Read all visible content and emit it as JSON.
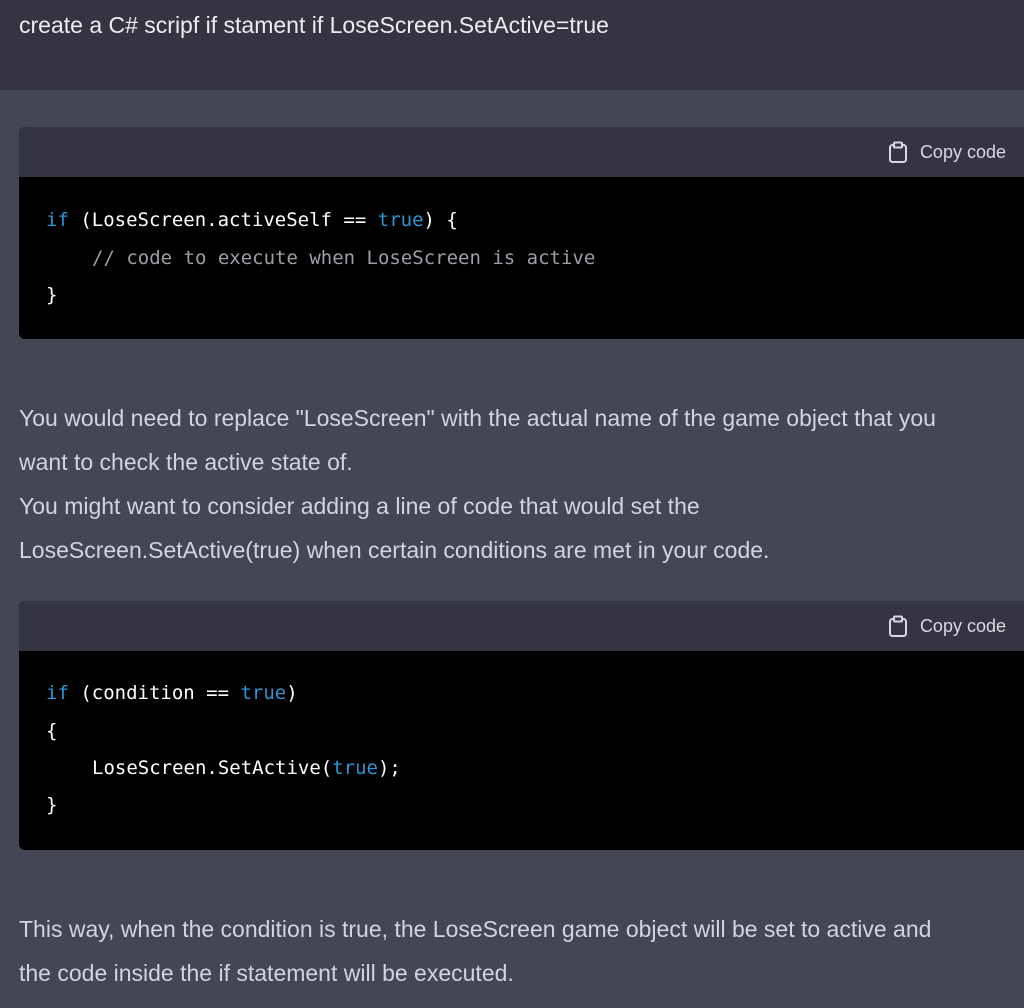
{
  "user_message": {
    "text": "create a C# scripf if stament if LoseScreen.SetActive=true"
  },
  "response": {
    "code_block_1": {
      "copy_label": "Copy code",
      "lines": {
        "l1_kw": "if",
        "l1_a": " (LoseScreen.activeSelf == ",
        "l1_true": "true",
        "l1_b": ") {",
        "l2_comment": "// code to execute when LoseScreen is active",
        "l3": "}"
      }
    },
    "paragraph_1": {
      "line1": "You would need to replace \"LoseScreen\" with the actual name of the game object that you",
      "line2": "want to check the active state of.",
      "line3": "You might want to consider adding a line of code that would set the",
      "line4": "LoseScreen.SetActive(true) when certain conditions are met in your code."
    },
    "code_block_2": {
      "copy_label": "Copy code",
      "lines": {
        "l1_kw": "if",
        "l1_a": " (condition == ",
        "l1_true": "true",
        "l1_b": ")",
        "l2": "{",
        "l3_a": "LoseScreen.SetActive(",
        "l3_true": "true",
        "l3_b": ");",
        "l4": "}"
      }
    },
    "paragraph_2": {
      "line1": "This way, when the condition is true, the LoseScreen game object will be set to active and",
      "line2": "the code inside the if statement will be executed."
    }
  },
  "colors": {
    "page_bg": "#444654",
    "user_bg": "#343541",
    "code_bg": "#000000",
    "keyword": "#2e95d3",
    "comment": "#9e9ea6"
  },
  "icons": {
    "copy": "clipboard-icon"
  }
}
